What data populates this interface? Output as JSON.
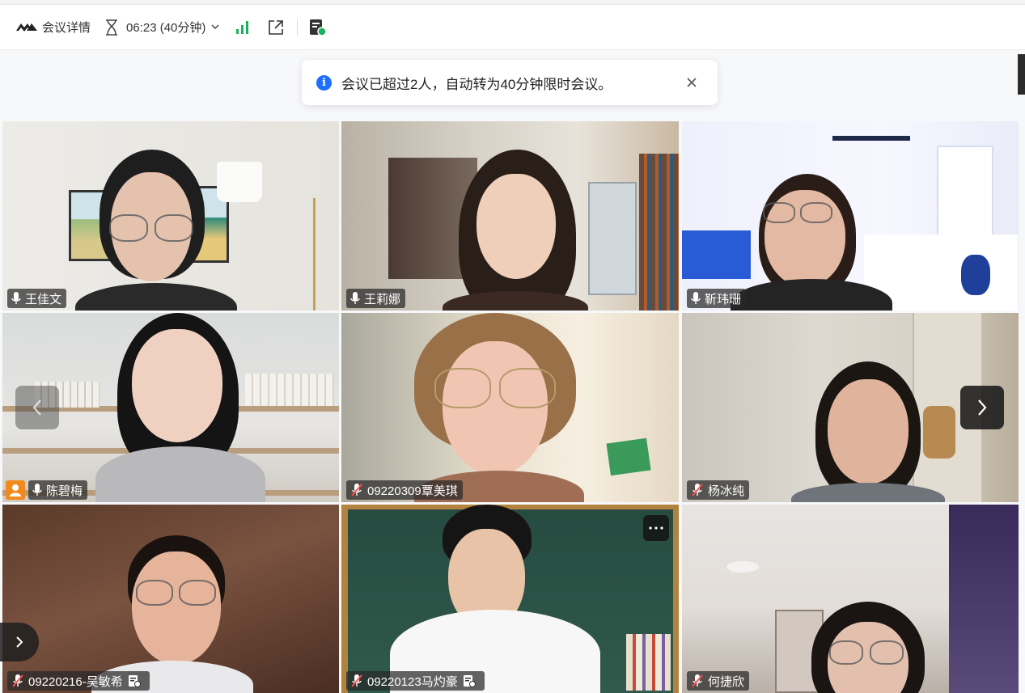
{
  "toolbar": {
    "meeting_details_label": "会议详情",
    "timer_label": "06:23 (40分钟)",
    "icons": [
      "logo-icon",
      "hourglass-icon",
      "chevron-down-icon",
      "signal-icon",
      "share-out-icon",
      "device-icon"
    ]
  },
  "notice": {
    "message": "会议已超过2人，自动转为40分钟限时会议。",
    "icon": "info-icon"
  },
  "participants": [
    {
      "name": "王佳文",
      "mic": "on"
    },
    {
      "name": "王莉娜",
      "mic": "on"
    },
    {
      "name": "靳玮珊",
      "mic": "on"
    },
    {
      "name": "陈碧梅",
      "mic": "on",
      "host": true
    },
    {
      "name": "09220309覃美琪",
      "mic": "muted"
    },
    {
      "name": "杨冰纯",
      "mic": "muted"
    },
    {
      "name": "09220216-吴敏希",
      "mic": "muted",
      "device_icon": true
    },
    {
      "name": "09220123马灼豪",
      "mic": "muted",
      "device_icon": true
    },
    {
      "name": "何捷欣",
      "mic": "muted"
    }
  ],
  "colors": {
    "accent": "#1f6fff",
    "signal_green": "#1bb25f",
    "host_orange": "#f08a1c",
    "name_tag_bg": "#282828",
    "muted_red": "#ff4d4f"
  }
}
